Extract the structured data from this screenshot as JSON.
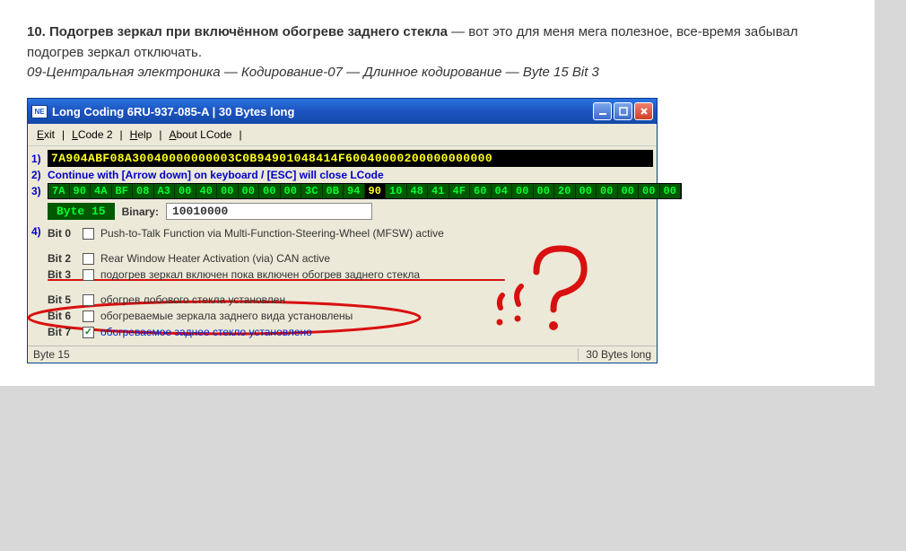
{
  "article": {
    "heading_bold": "10. Подогрев зеркал при включённом обогреве заднего стекла",
    "heading_rest": " — вот это для меня мега полезное, все-время забывал подогрев зеркал отключать.",
    "path": "09-Центральная электроника — Кодирование-07 — Длинное кодирование — Byte 15 Bit 3"
  },
  "window": {
    "title": "Long Coding  6RU-937-085-A  |  30 Bytes long",
    "icon_text": "NE-Tech",
    "menu": {
      "exit": "Exit",
      "lcode2": "LCode 2",
      "help": "Help",
      "about": "About LCode"
    },
    "row1_hex": "7A904ABF08A30040000000003C0B94901048414F60040000200000000000",
    "row2_instr": "Continue with [Arrow down] on keyboard / [ESC] will close LCode",
    "row3_bytes": [
      "7A",
      "90",
      "4A",
      "BF",
      "08",
      "A3",
      "00",
      "40",
      "00",
      "00",
      "00",
      "00",
      "3C",
      "0B",
      "94",
      "90",
      "10",
      "48",
      "41",
      "4F",
      "60",
      "04",
      "00",
      "00",
      "20",
      "00",
      "00",
      "00",
      "00",
      "00"
    ],
    "selected_byte_index": 15,
    "byte_label": "Byte 15",
    "binary_label": "Binary:",
    "binary_value": "10010000",
    "row4_num": "4)",
    "bits": [
      {
        "label": "Bit 0",
        "text": "Push-to-Talk Function via Multi-Function-Steering-Wheel (MFSW) active",
        "checked": false,
        "selected": false
      },
      {
        "label": "Bit 2",
        "text": "Rear Window Heater Activation (via) CAN active",
        "checked": false,
        "selected": false
      },
      {
        "label": "Bit 3",
        "text": "подогрев зеркал включен пока включен обогрев заднего стекла",
        "checked": false,
        "selected": false
      },
      {
        "label": "Bit 5",
        "text": "обогрев лобового стекла установлен",
        "checked": false,
        "selected": false
      },
      {
        "label": "Bit 6",
        "text": "обогреваемые зеркала заднего вида установлены",
        "checked": false,
        "selected": false
      },
      {
        "label": "Bit 7",
        "text": "обогреваемое заднее стекло установлено",
        "checked": true,
        "selected": true
      }
    ],
    "status_left": "Byte 15",
    "status_right": "30 Bytes long"
  }
}
